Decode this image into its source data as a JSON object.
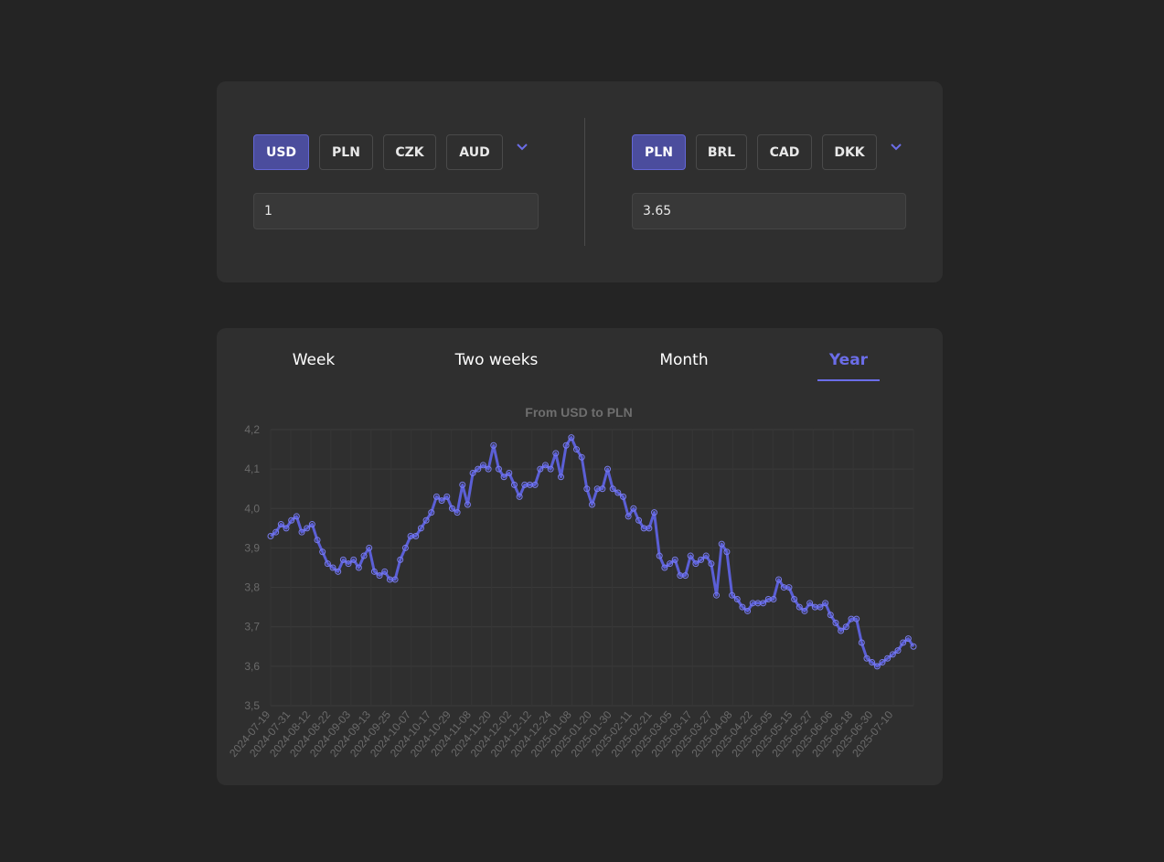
{
  "converter": {
    "from_currencies": [
      "USD",
      "PLN",
      "CZK",
      "AUD"
    ],
    "from_selected": "USD",
    "to_currencies": [
      "PLN",
      "BRL",
      "CAD",
      "DKK"
    ],
    "to_selected": "PLN",
    "from_amount": "1",
    "to_amount": "3.65"
  },
  "tabs": [
    {
      "label": "Week",
      "active": false
    },
    {
      "label": "Two weeks",
      "active": false
    },
    {
      "label": "Month",
      "active": false
    },
    {
      "label": "Year",
      "active": true
    }
  ],
  "colors": {
    "accent": "#6b6de8",
    "active_button": "#4b4d9d",
    "line": "#5b5fd6",
    "background": "#242424",
    "card": "#2f2f2f"
  },
  "icons": {
    "dropdown": "chevron-down-icon"
  },
  "chart_data": {
    "type": "line",
    "title": "From USD to PLN",
    "ylim": [
      3.5,
      4.2
    ],
    "yticks": [
      "3,5",
      "3,6",
      "3,7",
      "3,8",
      "3,9",
      "4,0",
      "4,1",
      "4,2"
    ],
    "xtick_labels": [
      "2024-07-19",
      "2024-07-31",
      "2024-08-12",
      "2024-08-22",
      "2024-09-03",
      "2024-09-13",
      "2024-09-25",
      "2024-10-07",
      "2024-10-17",
      "2024-10-29",
      "2024-11-08",
      "2024-11-20",
      "2024-12-02",
      "2024-12-12",
      "2024-12-24",
      "2025-01-08",
      "2025-01-20",
      "2025-01-30",
      "2025-02-11",
      "2025-02-21",
      "2025-03-05",
      "2025-03-17",
      "2025-03-27",
      "2025-04-08",
      "2025-04-22",
      "2025-05-05",
      "2025-05-15",
      "2025-05-27",
      "2025-06-06",
      "2025-06-18",
      "2025-06-30",
      "2025-07-10"
    ],
    "grid": true,
    "series": [
      {
        "values": [
          3.93,
          3.94,
          3.96,
          3.95,
          3.97,
          3.98,
          3.94,
          3.95,
          3.96,
          3.92,
          3.89,
          3.86,
          3.85,
          3.84,
          3.87,
          3.86,
          3.87,
          3.85,
          3.88,
          3.9,
          3.84,
          3.83,
          3.84,
          3.82,
          3.82,
          3.87,
          3.9,
          3.93,
          3.93,
          3.95,
          3.97,
          3.99,
          4.03,
          4.02,
          4.03,
          4.0,
          3.99,
          4.06,
          4.01,
          4.09,
          4.1,
          4.11,
          4.1,
          4.16,
          4.1,
          4.08,
          4.09,
          4.06,
          4.03,
          4.06,
          4.06,
          4.06,
          4.1,
          4.11,
          4.1,
          4.14,
          4.08,
          4.16,
          4.18,
          4.15,
          4.13,
          4.05,
          4.01,
          4.05,
          4.05,
          4.1,
          4.05,
          4.04,
          4.03,
          3.98,
          4.0,
          3.97,
          3.95,
          3.95,
          3.99,
          3.88,
          3.85,
          3.86,
          3.87,
          3.83,
          3.83,
          3.88,
          3.86,
          3.87,
          3.88,
          3.86,
          3.78,
          3.91,
          3.89,
          3.78,
          3.77,
          3.75,
          3.74,
          3.76,
          3.76,
          3.76,
          3.77,
          3.77,
          3.82,
          3.8,
          3.8,
          3.77,
          3.75,
          3.74,
          3.76,
          3.75,
          3.75,
          3.76,
          3.73,
          3.71,
          3.69,
          3.7,
          3.72,
          3.72,
          3.66,
          3.62,
          3.61,
          3.6,
          3.61,
          3.62,
          3.63,
          3.64,
          3.66,
          3.67,
          3.65
        ]
      }
    ]
  }
}
